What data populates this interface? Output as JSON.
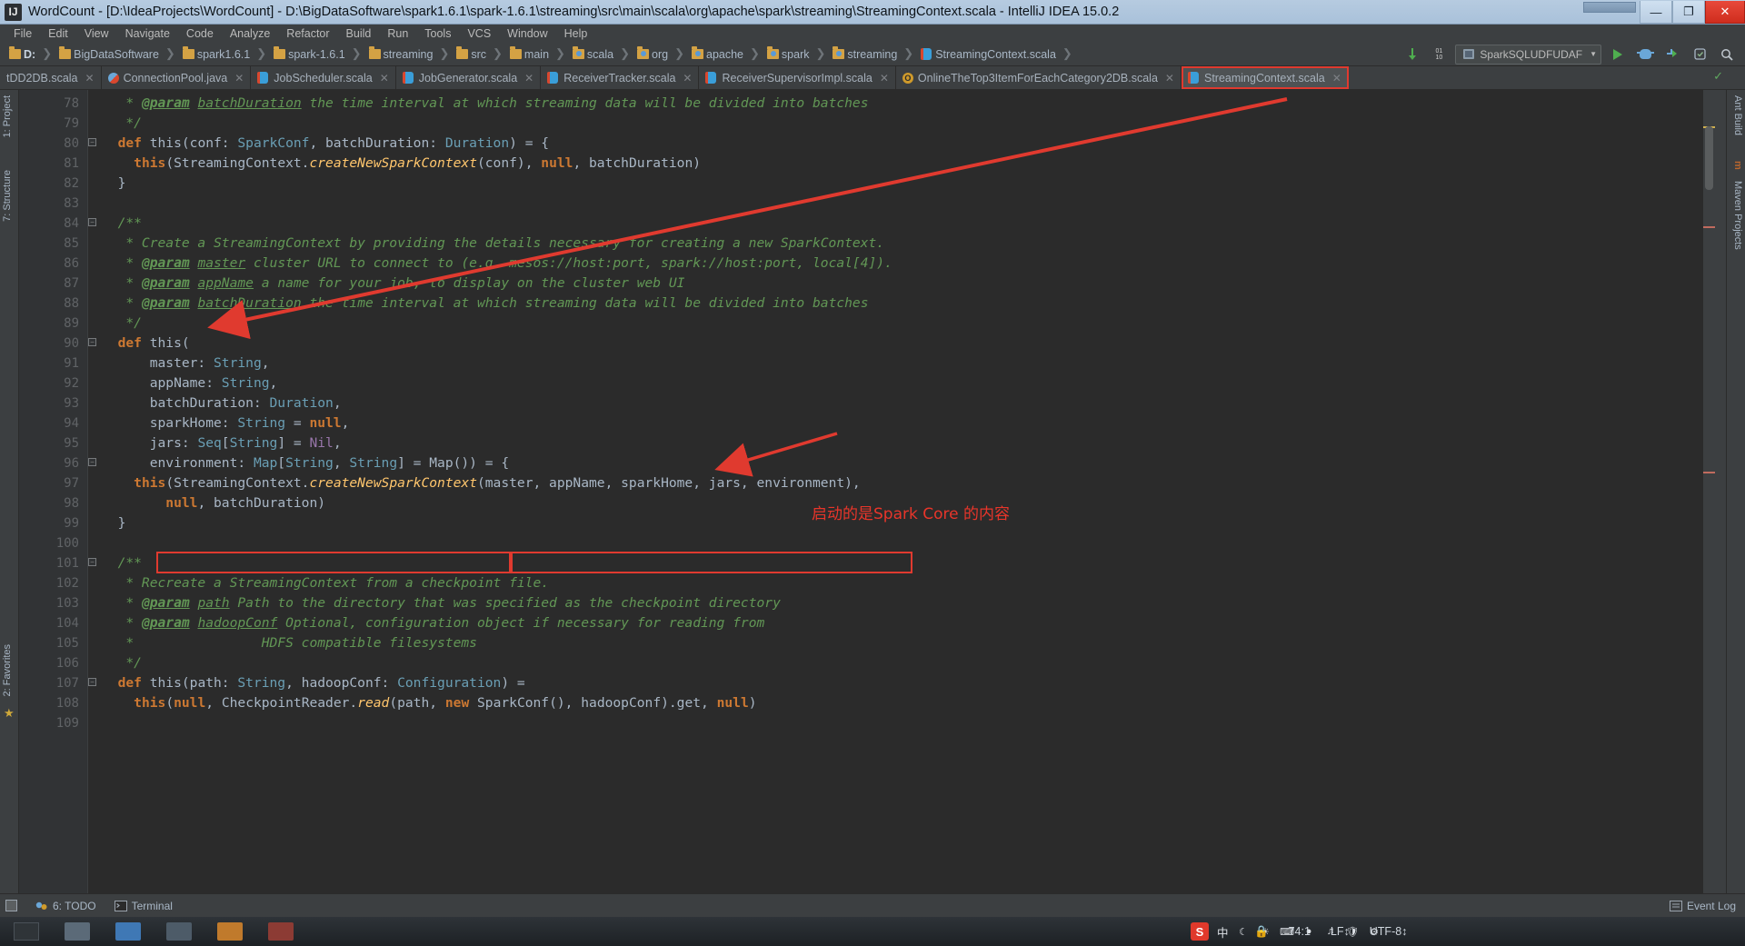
{
  "window": {
    "title": "WordCount - [D:\\IdeaProjects\\WordCount] - D:\\BigDataSoftware\\spark1.6.1\\spark-1.6.1\\streaming\\src\\main\\scala\\org\\apache\\spark\\streaming\\StreamingContext.scala - IntelliJ IDEA 15.0.2",
    "app_icon": "IJ",
    "minimize": "—",
    "maximize": "❐",
    "close": "✕"
  },
  "menu": [
    "File",
    "Edit",
    "View",
    "Navigate",
    "Code",
    "Analyze",
    "Refactor",
    "Build",
    "Run",
    "Tools",
    "VCS",
    "Window",
    "Help"
  ],
  "breadcrumb": [
    {
      "label": "D:",
      "icon": "folder-icon",
      "bold": true
    },
    {
      "label": "BigDataSoftware",
      "icon": "folder-icon",
      "bold": false
    },
    {
      "label": "spark1.6.1",
      "icon": "folder-icon",
      "bold": false
    },
    {
      "label": "spark-1.6.1",
      "icon": "folder-icon",
      "bold": false
    },
    {
      "label": "streaming",
      "icon": "folder-icon",
      "bold": false
    },
    {
      "label": "src",
      "icon": "folder-icon",
      "bold": false
    },
    {
      "label": "main",
      "icon": "folder-icon",
      "bold": false
    },
    {
      "label": "scala",
      "icon": "package-icon",
      "bold": false
    },
    {
      "label": "org",
      "icon": "package-icon",
      "bold": false
    },
    {
      "label": "apache",
      "icon": "package-icon",
      "bold": false
    },
    {
      "label": "spark",
      "icon": "package-icon",
      "bold": false
    },
    {
      "label": "streaming",
      "icon": "package-icon",
      "bold": false
    },
    {
      "label": "StreamingContext.scala",
      "icon": "scala-file-icon",
      "bold": false
    }
  ],
  "toolbar": {
    "run_config": "SparkSQLUDFUDAF",
    "run_config_arrow": "▼",
    "run_icon": "run-icon",
    "debug_icon": "debug-icon",
    "coverage_icon": "coverage-icon",
    "search_icon": "⚲",
    "settings_icon": "⚙",
    "binary_icon": "01\n10"
  },
  "tabs": [
    {
      "label": "tDD2DB.scala",
      "icon": "scala-file-icon",
      "active": false,
      "highlight": false,
      "clipped": true
    },
    {
      "label": "ConnectionPool.java",
      "icon": "java-file-icon",
      "active": false,
      "highlight": false
    },
    {
      "label": "JobScheduler.scala",
      "icon": "scala-file-icon",
      "active": false,
      "highlight": false
    },
    {
      "label": "JobGenerator.scala",
      "icon": "scala-file-icon",
      "active": false,
      "highlight": false
    },
    {
      "label": "ReceiverTracker.scala",
      "icon": "scala-file-icon",
      "active": false,
      "highlight": false
    },
    {
      "label": "ReceiverSupervisorImpl.scala",
      "icon": "scala-file-icon",
      "active": false,
      "highlight": false
    },
    {
      "label": "OnlineTheTop3ItemForEachCategory2DB.scala",
      "icon": "object-icon",
      "active": false,
      "highlight": false
    },
    {
      "label": "StreamingContext.scala",
      "icon": "scala-file-icon",
      "active": true,
      "highlight": true
    }
  ],
  "left_rail": [
    {
      "label": "1: Project",
      "name": "tool-window-project"
    },
    {
      "label": "7: Structure",
      "name": "tool-window-structure"
    },
    {
      "label": "2: Favorites",
      "name": "tool-window-favorites"
    }
  ],
  "right_rail": [
    {
      "label": "Ant Build",
      "name": "tool-window-ant-build"
    },
    {
      "label": "Maven Projects",
      "name": "tool-window-maven-projects"
    }
  ],
  "editor": {
    "first_line": 78,
    "last_line": 109,
    "lines": [
      {
        "n": 78,
        "segs": [
          {
            "t": "   * ",
            "c": "cmt"
          },
          {
            "t": "@param",
            "c": "tag"
          },
          {
            "t": " ",
            "c": "cmt"
          },
          {
            "t": "batchDuration",
            "c": "prm"
          },
          {
            "t": " the time interval at which streaming data will be divided into batches",
            "c": "cmt"
          }
        ]
      },
      {
        "n": 79,
        "segs": [
          {
            "t": "   */",
            "c": "cmt"
          }
        ]
      },
      {
        "n": 80,
        "segs": [
          {
            "t": "  ",
            "c": "pl"
          },
          {
            "t": "def",
            "c": "kw"
          },
          {
            "t": " this(conf: ",
            "c": "pl"
          },
          {
            "t": "SparkConf",
            "c": "cls"
          },
          {
            "t": ", batchDuration: ",
            "c": "pl"
          },
          {
            "t": "Duration",
            "c": "cls"
          },
          {
            "t": ") = {",
            "c": "pl"
          }
        ],
        "fold": true
      },
      {
        "n": 81,
        "segs": [
          {
            "t": "    ",
            "c": "pl"
          },
          {
            "t": "this",
            "c": "kw"
          },
          {
            "t": "(StreamingContext.",
            "c": "pl"
          },
          {
            "t": "createNewSparkContext",
            "c": "mtd"
          },
          {
            "t": "(conf), ",
            "c": "pl"
          },
          {
            "t": "null",
            "c": "nul"
          },
          {
            "t": ", batchDuration)",
            "c": "pl"
          }
        ]
      },
      {
        "n": 82,
        "segs": [
          {
            "t": "  }",
            "c": "pl"
          }
        ]
      },
      {
        "n": 83,
        "segs": [
          {
            "t": "",
            "c": "pl"
          }
        ]
      },
      {
        "n": 84,
        "segs": [
          {
            "t": "  /**",
            "c": "cmt"
          }
        ],
        "fold": true
      },
      {
        "n": 85,
        "segs": [
          {
            "t": "   * Create a StreamingContext by providing the details necessary for creating a new SparkContext.",
            "c": "cmt"
          }
        ]
      },
      {
        "n": 86,
        "segs": [
          {
            "t": "   * ",
            "c": "cmt"
          },
          {
            "t": "@param",
            "c": "tag"
          },
          {
            "t": " ",
            "c": "cmt"
          },
          {
            "t": "master",
            "c": "prm"
          },
          {
            "t": " cluster URL to connect to (e.g. mesos://host:port, spark://host:port, local[4]).",
            "c": "cmt"
          }
        ]
      },
      {
        "n": 87,
        "segs": [
          {
            "t": "   * ",
            "c": "cmt"
          },
          {
            "t": "@param",
            "c": "tag"
          },
          {
            "t": " ",
            "c": "cmt"
          },
          {
            "t": "appName",
            "c": "prm"
          },
          {
            "t": " a name for your job, to display on the cluster web UI",
            "c": "cmt"
          }
        ]
      },
      {
        "n": 88,
        "segs": [
          {
            "t": "   * ",
            "c": "cmt"
          },
          {
            "t": "@param",
            "c": "tag"
          },
          {
            "t": " ",
            "c": "cmt"
          },
          {
            "t": "batchDuration",
            "c": "prm"
          },
          {
            "t": " the time interval at which streaming data will be divided into batches",
            "c": "cmt"
          }
        ]
      },
      {
        "n": 89,
        "segs": [
          {
            "t": "   */",
            "c": "cmt"
          }
        ]
      },
      {
        "n": 90,
        "segs": [
          {
            "t": "  ",
            "c": "pl"
          },
          {
            "t": "def",
            "c": "kw"
          },
          {
            "t": " this(",
            "c": "pl"
          }
        ],
        "fold": true
      },
      {
        "n": 91,
        "segs": [
          {
            "t": "      master: ",
            "c": "pl"
          },
          {
            "t": "String",
            "c": "cls"
          },
          {
            "t": ",",
            "c": "pl"
          }
        ]
      },
      {
        "n": 92,
        "segs": [
          {
            "t": "      appName: ",
            "c": "pl"
          },
          {
            "t": "String",
            "c": "cls"
          },
          {
            "t": ",",
            "c": "pl"
          }
        ]
      },
      {
        "n": 93,
        "segs": [
          {
            "t": "      batchDuration: ",
            "c": "pl"
          },
          {
            "t": "Duration",
            "c": "cls"
          },
          {
            "t": ",",
            "c": "pl"
          }
        ]
      },
      {
        "n": 94,
        "segs": [
          {
            "t": "      sparkHome: ",
            "c": "pl"
          },
          {
            "t": "String",
            "c": "cls"
          },
          {
            "t": " = ",
            "c": "pl"
          },
          {
            "t": "null",
            "c": "nul"
          },
          {
            "t": ",",
            "c": "pl"
          }
        ]
      },
      {
        "n": 95,
        "segs": [
          {
            "t": "      jars: ",
            "c": "pl"
          },
          {
            "t": "Seq",
            "c": "cls"
          },
          {
            "t": "[",
            "c": "pl"
          },
          {
            "t": "String",
            "c": "cls"
          },
          {
            "t": "] = ",
            "c": "pl"
          },
          {
            "t": "Nil",
            "c": "tin"
          },
          {
            "t": ",",
            "c": "pl"
          }
        ]
      },
      {
        "n": 96,
        "segs": [
          {
            "t": "      environment: ",
            "c": "pl"
          },
          {
            "t": "Map",
            "c": "cls"
          },
          {
            "t": "[",
            "c": "pl"
          },
          {
            "t": "String",
            "c": "cls"
          },
          {
            "t": ", ",
            "c": "pl"
          },
          {
            "t": "String",
            "c": "cls"
          },
          {
            "t": "] = Map()) = {",
            "c": "pl"
          }
        ],
        "fold": true
      },
      {
        "n": 97,
        "segs": [
          {
            "t": "    ",
            "c": "pl"
          },
          {
            "t": "this",
            "c": "kw"
          },
          {
            "t": "(StreamingContext.",
            "c": "pl"
          },
          {
            "t": "createNewSparkContext",
            "c": "mtd"
          },
          {
            "t": "(master, appName, sparkHome, jars, environment),",
            "c": "pl"
          }
        ]
      },
      {
        "n": 98,
        "segs": [
          {
            "t": "        ",
            "c": "pl"
          },
          {
            "t": "null",
            "c": "nul"
          },
          {
            "t": ", batchDuration)",
            "c": "pl"
          }
        ]
      },
      {
        "n": 99,
        "segs": [
          {
            "t": "  }",
            "c": "pl"
          }
        ]
      },
      {
        "n": 100,
        "segs": [
          {
            "t": "",
            "c": "pl"
          }
        ]
      },
      {
        "n": 101,
        "segs": [
          {
            "t": "  /**",
            "c": "cmt"
          }
        ],
        "fold": true
      },
      {
        "n": 102,
        "segs": [
          {
            "t": "   * Recreate a StreamingContext from a checkpoint file.",
            "c": "cmt"
          }
        ]
      },
      {
        "n": 103,
        "segs": [
          {
            "t": "   * ",
            "c": "cmt"
          },
          {
            "t": "@param",
            "c": "tag"
          },
          {
            "t": " ",
            "c": "cmt"
          },
          {
            "t": "path",
            "c": "prm"
          },
          {
            "t": " Path to the directory that was specified as the checkpoint directory",
            "c": "cmt"
          }
        ]
      },
      {
        "n": 104,
        "segs": [
          {
            "t": "   * ",
            "c": "cmt"
          },
          {
            "t": "@param",
            "c": "tag"
          },
          {
            "t": " ",
            "c": "cmt"
          },
          {
            "t": "hadoopConf",
            "c": "prm"
          },
          {
            "t": " Optional, configuration object if necessary for reading from",
            "c": "cmt"
          }
        ]
      },
      {
        "n": 105,
        "segs": [
          {
            "t": "   *                HDFS compatible filesystems",
            "c": "cmt"
          }
        ]
      },
      {
        "n": 106,
        "segs": [
          {
            "t": "   */",
            "c": "cmt"
          }
        ]
      },
      {
        "n": 107,
        "segs": [
          {
            "t": "  ",
            "c": "pl"
          },
          {
            "t": "def",
            "c": "kw"
          },
          {
            "t": " this(path: ",
            "c": "pl"
          },
          {
            "t": "String",
            "c": "cls"
          },
          {
            "t": ", hadoopConf: ",
            "c": "pl"
          },
          {
            "t": "Configuration",
            "c": "cls"
          },
          {
            "t": ") =",
            "c": "pl"
          }
        ],
        "fold": true
      },
      {
        "n": 108,
        "segs": [
          {
            "t": "    ",
            "c": "pl"
          },
          {
            "t": "this",
            "c": "kw"
          },
          {
            "t": "(",
            "c": "pl"
          },
          {
            "t": "null",
            "c": "nul"
          },
          {
            "t": ", CheckpointReader.",
            "c": "pl"
          },
          {
            "t": "read",
            "c": "mtd"
          },
          {
            "t": "(path, ",
            "c": "pl"
          },
          {
            "t": "new",
            "c": "kw"
          },
          {
            "t": " SparkConf(), hadoopConf).get, ",
            "c": "pl"
          },
          {
            "t": "null",
            "c": "nul"
          },
          {
            "t": ")",
            "c": "pl"
          }
        ]
      },
      {
        "n": 109,
        "segs": [
          {
            "t": "",
            "c": "pl"
          }
        ]
      }
    ]
  },
  "annotations": {
    "note_text": "启动的是Spark Core 的内容",
    "note_color": "#e8352a",
    "box_color": "#e03a2f"
  },
  "bottom_bar": {
    "todo": "6: TODO",
    "terminal": "Terminal",
    "event_log": "Event Log"
  },
  "status_bar": {
    "caret": "74:1",
    "line_sep": "LF↕",
    "encoding": "UTF-8↕",
    "lock": "🔒"
  },
  "taskbar": {
    "ime_label": "S",
    "ime_mode": "中",
    "tray_icons": [
      "moon-icon",
      "weather-icon",
      "keyboard-icon",
      "network-icon",
      "volume-icon",
      "shield-icon",
      "settings-icon"
    ]
  }
}
